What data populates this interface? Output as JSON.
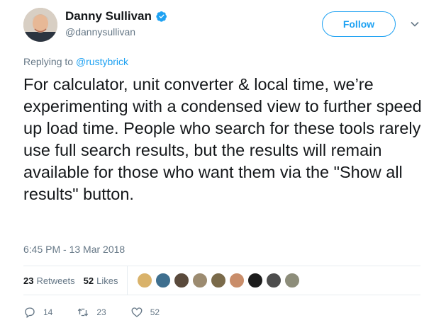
{
  "user": {
    "name": "Danny Sullivan",
    "handle": "@dannysullivan"
  },
  "follow_label": "Follow",
  "reply": {
    "prefix": "Replying to",
    "target": "@rustybrick"
  },
  "tweet_text": "For calculator, unit converter & local time, we’re experimenting with a condensed view to further speed up load time. People who search for these tools rarely use full search results, but the results will remain available for those who want them via the \"Show all results\" button.",
  "timestamp": "6:45 PM - 13 Mar 2018",
  "stats": {
    "retweets_count": "23",
    "retweets_label": "Retweets",
    "likes_count": "52",
    "likes_label": "Likes"
  },
  "liker_avatars": [
    "avatar-1",
    "avatar-2",
    "avatar-3",
    "avatar-4",
    "avatar-5",
    "avatar-6",
    "avatar-7",
    "avatar-8",
    "avatar-9"
  ],
  "actions": {
    "reply_count": "14",
    "retweet_count": "23",
    "like_count": "52"
  },
  "colors": {
    "accent": "#1da1f2",
    "secondary_text": "#657786",
    "divider": "#e6ecf0"
  }
}
